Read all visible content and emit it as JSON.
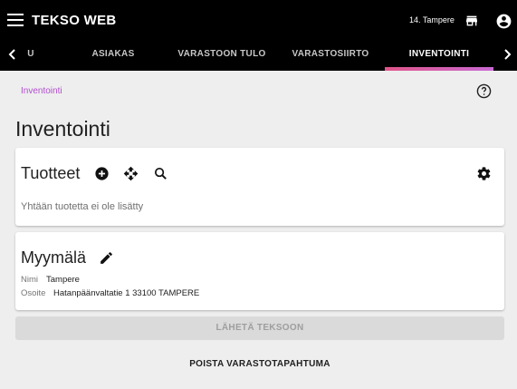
{
  "app": {
    "title": "TEKSO WEB",
    "store": "14. Tampere"
  },
  "icons": {
    "menu": "menu-icon",
    "store": "store-icon",
    "account": "account-circle-icon",
    "tab_left": "chevron-left-icon",
    "tab_right": "chevron-right-icon",
    "help": "help-circle-icon",
    "add": "add-circle-icon",
    "move": "move-icon",
    "search": "search-icon",
    "settings": "gear-icon",
    "edit": "pencil-icon"
  },
  "tabs": [
    {
      "label": "U"
    },
    {
      "label": "ASIAKAS"
    },
    {
      "label": "VARASTOON TULO"
    },
    {
      "label": "VARASTOSIIRTO"
    },
    {
      "label": "INVENTOINTI",
      "active": true
    }
  ],
  "breadcrumb": "Inventointi",
  "page_title": "Inventointi",
  "products": {
    "title": "Tuotteet",
    "empty_text": "Yhtään tuotetta ei ole lisätty"
  },
  "store_card": {
    "title": "Myymälä",
    "name_label": "Nimi",
    "name_value": "Tampere",
    "address_label": "Osoite",
    "address_value": "Hatanpäänvaltatie 1 33100 TAMPERE"
  },
  "actions": {
    "send_label": "LÄHETÄ TEKSOON",
    "delete_label": "POISTA VARASTOTAPAHTUMA"
  },
  "colors": {
    "topbar": "#000000",
    "background": "#eeeeee",
    "accent": "#b24fcf",
    "tab_indicator_start": "#e0558a",
    "tab_indicator_end": "#c96ad3"
  }
}
